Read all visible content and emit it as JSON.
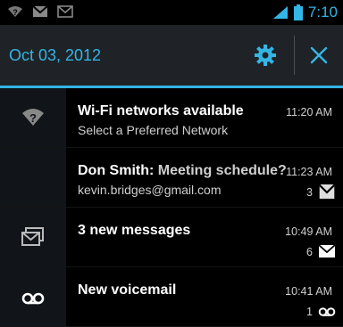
{
  "status_bar": {
    "icons": [
      "wifi-question-icon",
      "gmail-icon",
      "mail-icon",
      "signal-icon",
      "battery-icon"
    ],
    "time": "7:10"
  },
  "header": {
    "date": "Oct 03, 2012",
    "settings_icon": "gear-icon",
    "close_icon": "close-icon"
  },
  "colors": {
    "accent": "#33b5e5",
    "background": "#000000",
    "header_bg": "#1f2327",
    "icon_column_bg": "#111418"
  },
  "notifications": [
    {
      "icon": "wifi-question-icon",
      "title": "Wi-Fi networks available",
      "subtitle": "Select a Preferred Network",
      "time": "11:20 AM"
    },
    {
      "icon": "none",
      "title": "Don Smith:",
      "title_suffix": " Meeting schedule?",
      "subtitle": "kevin.bridges@gmail.com",
      "time": "11:23 AM",
      "count": "3",
      "small_icon": "gmail-icon"
    },
    {
      "icon": "mail-stack-icon",
      "title": "3 new messages",
      "time": "10:49 AM",
      "count": "6",
      "small_icon": "mail-icon"
    },
    {
      "icon": "voicemail-icon",
      "title": "New voicemail",
      "time": "10:41 AM",
      "count": "1",
      "small_icon": "voicemail-icon"
    }
  ]
}
